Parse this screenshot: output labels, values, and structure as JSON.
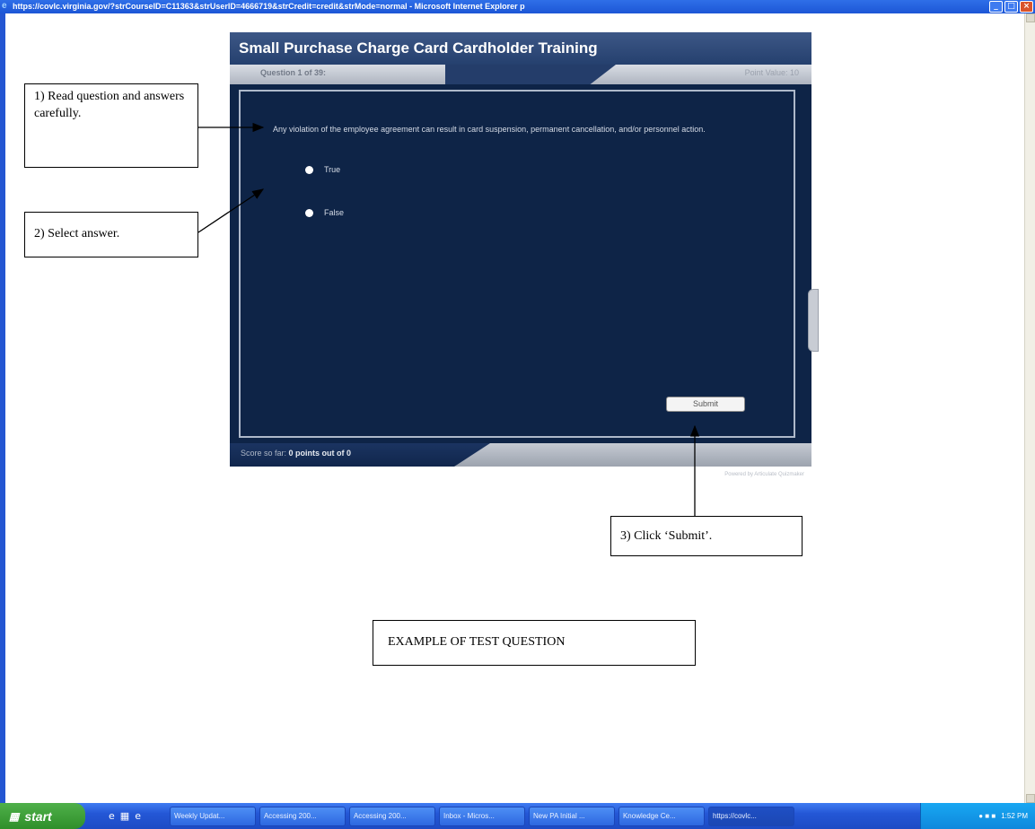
{
  "window": {
    "title": "https://covlc.virginia.gov/?strCourseID=C11363&strUserID=4666719&strCredit=credit&strMode=normal - Microsoft Internet Explorer p",
    "buttons": [
      "_",
      "□",
      "×"
    ]
  },
  "module": {
    "title": "Small Purchase Charge Card Cardholder Training",
    "question_count": "Question 1 of 39:",
    "point_value": "Point Value: 10",
    "question_text": "Any violation of the employee agreement can result in card suspension, permanent cancellation, and/or personnel action.",
    "options": [
      "True",
      "False"
    ],
    "submit_label": "Submit",
    "score_prefix": "Score so far:",
    "score_value": "0 points out of 0",
    "powered_by": "Powered by Articulate Quizmaker"
  },
  "callouts": {
    "read": "1) Read question and answers carefully.",
    "select": "2) Select answer.",
    "submit": "3) Click ‘Submit’.",
    "example": "EXAMPLE OF TEST QUESTION"
  },
  "taskbar": {
    "start": "start",
    "items": [
      "Weekly Updat...",
      "Accessing 200...",
      "Accessing 200...",
      "Inbox - Micros...",
      "New PA Initial ...",
      "Knowledge Ce...",
      "https://covlc..."
    ],
    "clock": "1:52 PM"
  },
  "icons": [
    "ie-icon",
    "minimize-icon",
    "maximize-icon",
    "close-icon",
    "windows-flag-icon",
    "radio-icon"
  ]
}
